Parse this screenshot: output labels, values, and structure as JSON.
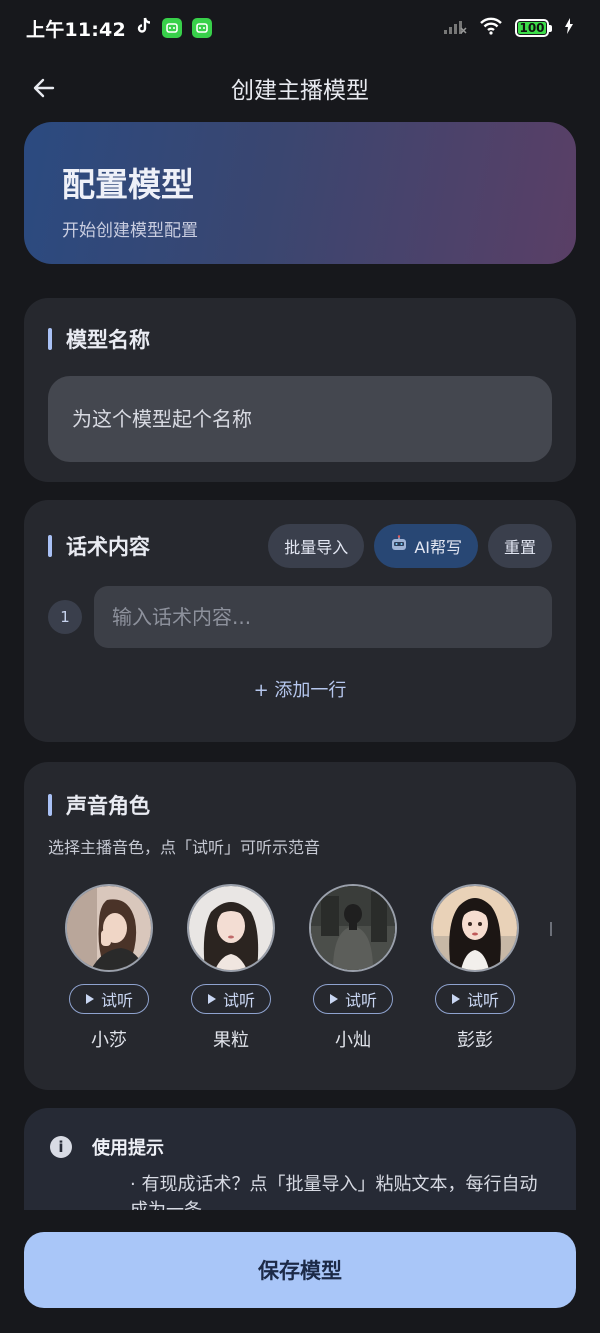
{
  "status_bar": {
    "time": "上午11:42",
    "battery": "100"
  },
  "top_bar": {
    "title": "创建主播模型"
  },
  "hero": {
    "title": "配置模型",
    "subtitle": "开始创建模型配置"
  },
  "name_section": {
    "title": "模型名称",
    "placeholder": "为这个模型起个名称"
  },
  "script_section": {
    "title": "话术内容",
    "buttons": {
      "batch_import": "批量导入",
      "ai_help": "AI帮写",
      "reset": "重置"
    },
    "lines": [
      {
        "number": "1",
        "placeholder": "输入话术内容..."
      }
    ],
    "add_line": "+ 添加一行"
  },
  "voice_section": {
    "title": "声音角色",
    "subtitle": "选择主播音色，点「试听」可听示范音",
    "listen_label": "试听",
    "voices": [
      {
        "name": "小莎"
      },
      {
        "name": "果粒"
      },
      {
        "name": "小灿"
      },
      {
        "name": "彭彭"
      }
    ]
  },
  "tips": {
    "title": "使用提示",
    "text": "· 有现成话术？点「批量导入」粘贴文本，每行自动成为一条"
  },
  "save_button": "保存模型",
  "colors": {
    "background": "#17181c",
    "card": "#26282e",
    "accent": "#a9c1f5",
    "save_button": "#a9c6f8"
  }
}
